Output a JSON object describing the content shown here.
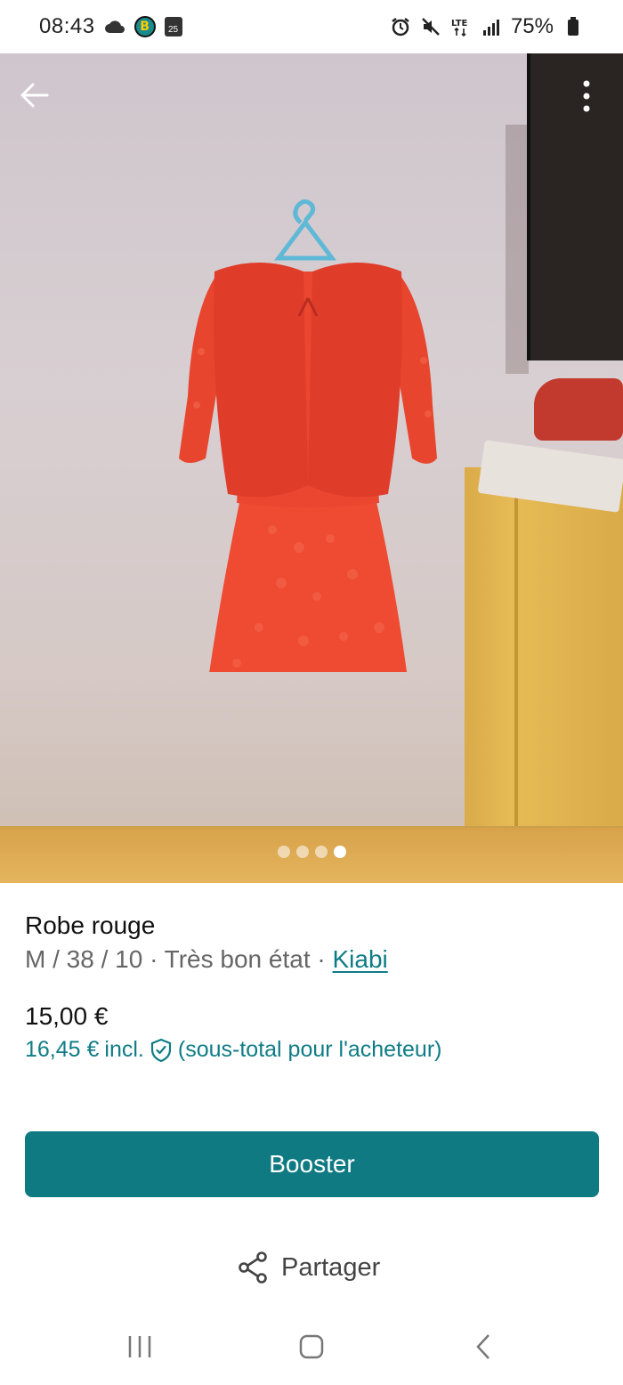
{
  "status_bar": {
    "time": "08:43",
    "calendar_day": "25",
    "b_badge": "B",
    "battery": "75%",
    "icons": [
      "cloud-icon",
      "b-app-icon",
      "calendar-icon",
      "alarm-icon",
      "mute-icon",
      "lte-icon",
      "signal-icon",
      "battery-icon"
    ]
  },
  "photo": {
    "page_indicator": {
      "total": 4,
      "active_index": 3
    }
  },
  "listing": {
    "title": "Robe rouge",
    "size_and_condition": "M / 38 / 10 · Très bon état · ",
    "brand": "Kiabi",
    "price": "15,00 €",
    "buyer_price": "16,45 €",
    "buyer_price_incl": "incl.",
    "buyer_price_note": "(sous-total pour l'acheteur)"
  },
  "actions": {
    "booster_label": "Booster",
    "share_label": "Partager"
  },
  "colors": {
    "accent": "#0f7a82",
    "link": "#0f7c85",
    "muted_text": "#666666"
  }
}
